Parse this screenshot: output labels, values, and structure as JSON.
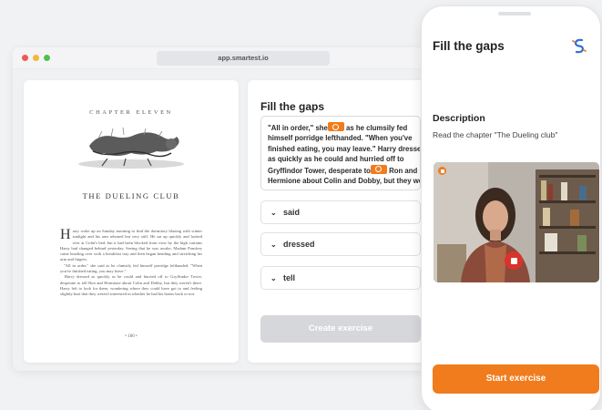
{
  "browser": {
    "url": "app.smartest.io",
    "dots": [
      "#ee5b55",
      "#f5b73a",
      "#4fc24a"
    ]
  },
  "book": {
    "chapter_label": "CHAPTER ELEVEN",
    "title": "THE DUELING CLUB",
    "dropcap": "H",
    "paragraphs": [
      "arry woke up on Sunday morning to find the dormitory blazing with winter sunlight and his arm reboned but very stiff. He sat up quickly and looked over at Colin's bed, but it had been blocked from view by the high curtains Harry had changed behind yesterday. Seeing that he was awake, Madam Pomfrey came bustling over with a breakfast tray and then began bending and stretching his arm and fingers.",
      "\"All in order,\" she said as he clumsily fed himself porridge lefthanded. \"When you've finished eating, you may leave.\"",
      "Harry dressed as quickly as he could and hurried off to Gryffindor Tower, desperate to tell Ron and Hermione about Colin and Dobby, but they weren't there. Harry left to look for them, wondering where they could have got to and feeling slightly hurt that they weren't interested in whether he had his bones back or not."
    ],
    "page_number": "• 180 •"
  },
  "exercise": {
    "title": "Fill the gaps",
    "text_lines": [
      {
        "before": "\"All in order,\" she",
        "gap": true,
        "after": " as he clumsily fed"
      },
      {
        "before": "himself porridge lefthanded. \"When you've",
        "gap": false,
        "after": ""
      },
      {
        "before": "finished eating, you may leave.\" Harry dressed",
        "gap": false,
        "after": ""
      },
      {
        "before": "as quickly as he could and hurried off to",
        "gap": false,
        "after": ""
      },
      {
        "before": "Gryffindor Tower, desperate to",
        "gap": true,
        "after": " Ron and"
      },
      {
        "before": "Hermione about Colin and Dobby, but they weren't",
        "gap": false,
        "after": ""
      }
    ],
    "options": [
      "said",
      "dressed",
      "tell"
    ],
    "create_button": "Create exercise"
  },
  "phone": {
    "title": "Fill the gaps",
    "description_label": "Description",
    "description_text": "Read the chapter \"The Dueling club\"",
    "start_button": "Start exercise"
  },
  "colors": {
    "accent": "#f07c1d",
    "disabled": "#d6d7db",
    "stop": "#d9332b"
  }
}
